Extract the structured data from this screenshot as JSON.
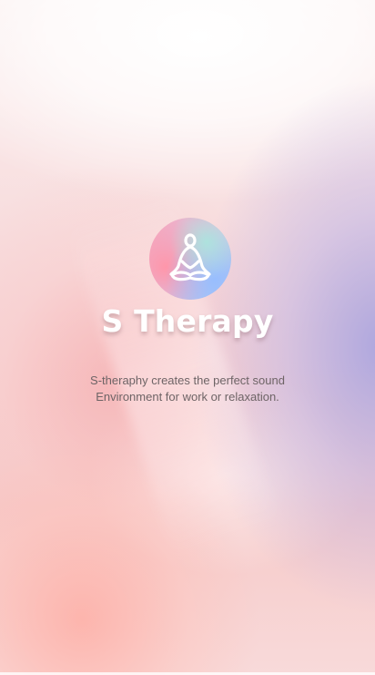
{
  "app": {
    "title": "S Therapy",
    "tagline_line1": "S-theraphy creates the perfect sound",
    "tagline_line2": "Environment for work or relaxation.",
    "logo_icon": "meditation-icon"
  },
  "colors": {
    "title_text": "#ffffff",
    "tagline_text": "#6e6466",
    "logo_gradient_start": "#f8a9bd",
    "logo_gradient_end": "#9fc3f3"
  }
}
